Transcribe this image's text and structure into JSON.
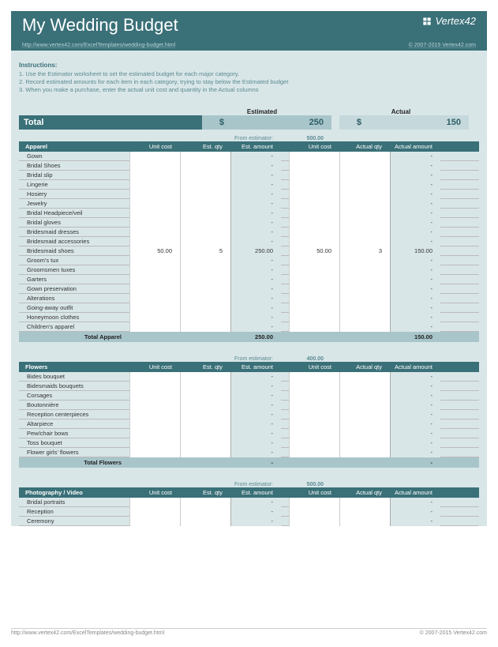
{
  "header": {
    "title": "My Wedding Budget",
    "logo": "Vertex42",
    "url": "http://www.vertex42.com/ExcelTemplates/wedding-budget.html",
    "copyright": "© 2007-2015 Vertex42.com"
  },
  "instructions": {
    "heading": "Instructions:",
    "lines": [
      "1. Use the Estimator worksheet to set the estimated budget for each major category.",
      "2. Record estimated amounts for each item in each category, trying to stay below the Estimated budget",
      "3. When you make a purchase, enter the actual unit cost and quantity in the Actual columns"
    ]
  },
  "totals": {
    "est_label": "Estimated",
    "act_label": "Actual",
    "label": "Total",
    "cur": "$",
    "est": "250",
    "act": "150"
  },
  "cols": {
    "unit_cost": "Unit cost",
    "est_qty": "Est. qty",
    "est_amt": "Est. amount",
    "act_unit": "Unit cost",
    "act_qty": "Actual qty",
    "act_amt": "Actual amount"
  },
  "estimator_label": "From estimator:",
  "categories": [
    {
      "name": "Apparel",
      "from_estimator": "500.00",
      "items": [
        {
          "name": "Gown",
          "uc": "",
          "eq": "",
          "ea": "-",
          "au": "",
          "aq": "",
          "aa": "-"
        },
        {
          "name": "Bridal Shoes",
          "uc": "",
          "eq": "",
          "ea": "-",
          "au": "",
          "aq": "",
          "aa": "-"
        },
        {
          "name": "Bridal slip",
          "uc": "",
          "eq": "",
          "ea": "-",
          "au": "",
          "aq": "",
          "aa": "-"
        },
        {
          "name": "Lingerie",
          "uc": "",
          "eq": "",
          "ea": "-",
          "au": "",
          "aq": "",
          "aa": "-"
        },
        {
          "name": "Hosiery",
          "uc": "",
          "eq": "",
          "ea": "-",
          "au": "",
          "aq": "",
          "aa": "-"
        },
        {
          "name": "Jewelry",
          "uc": "",
          "eq": "",
          "ea": "-",
          "au": "",
          "aq": "",
          "aa": "-"
        },
        {
          "name": "Bridal Headpiece/veil",
          "uc": "",
          "eq": "",
          "ea": "-",
          "au": "",
          "aq": "",
          "aa": "-"
        },
        {
          "name": "Bridal gloves",
          "uc": "",
          "eq": "",
          "ea": "-",
          "au": "",
          "aq": "",
          "aa": "-"
        },
        {
          "name": "Bridesmaid dresses",
          "uc": "",
          "eq": "",
          "ea": "-",
          "au": "",
          "aq": "",
          "aa": "-"
        },
        {
          "name": "Bridesmaid accessories",
          "uc": "",
          "eq": "",
          "ea": "-",
          "au": "",
          "aq": "",
          "aa": "-"
        },
        {
          "name": "Bridesmaid shoes",
          "uc": "50.00",
          "eq": "5",
          "ea": "250.00",
          "au": "50.00",
          "aq": "3",
          "aa": "150.00"
        },
        {
          "name": "Groom's tux",
          "uc": "",
          "eq": "",
          "ea": "-",
          "au": "",
          "aq": "",
          "aa": "-"
        },
        {
          "name": "Groomsmen tuxes",
          "uc": "",
          "eq": "",
          "ea": "-",
          "au": "",
          "aq": "",
          "aa": "-"
        },
        {
          "name": "Garters",
          "uc": "",
          "eq": "",
          "ea": "-",
          "au": "",
          "aq": "",
          "aa": "-"
        },
        {
          "name": "Gown preservation",
          "uc": "",
          "eq": "",
          "ea": "-",
          "au": "",
          "aq": "",
          "aa": "-"
        },
        {
          "name": "Alterations",
          "uc": "",
          "eq": "",
          "ea": "-",
          "au": "",
          "aq": "",
          "aa": "-"
        },
        {
          "name": "Going-away outfit",
          "uc": "",
          "eq": "",
          "ea": "-",
          "au": "",
          "aq": "",
          "aa": "-"
        },
        {
          "name": "Honeymoon clothes",
          "uc": "",
          "eq": "",
          "ea": "-",
          "au": "",
          "aq": "",
          "aa": "-"
        },
        {
          "name": "Children's apparel",
          "uc": "",
          "eq": "",
          "ea": "-",
          "au": "",
          "aq": "",
          "aa": "-"
        }
      ],
      "subtotal": {
        "label": "Total Apparel",
        "est": "250.00",
        "act": "150.00"
      }
    },
    {
      "name": "Flowers",
      "from_estimator": "400.00",
      "items": [
        {
          "name": "Bides bouquet",
          "uc": "",
          "eq": "",
          "ea": "-",
          "au": "",
          "aq": "",
          "aa": "-"
        },
        {
          "name": "Bidesmaids bouquets",
          "uc": "",
          "eq": "",
          "ea": "-",
          "au": "",
          "aq": "",
          "aa": "-"
        },
        {
          "name": "Corsages",
          "uc": "",
          "eq": "",
          "ea": "-",
          "au": "",
          "aq": "",
          "aa": "-"
        },
        {
          "name": "Boutonnière",
          "uc": "",
          "eq": "",
          "ea": "-",
          "au": "",
          "aq": "",
          "aa": "-"
        },
        {
          "name": "Reception centerpieces",
          "uc": "",
          "eq": "",
          "ea": "-",
          "au": "",
          "aq": "",
          "aa": "-"
        },
        {
          "name": "Altarpiece",
          "uc": "",
          "eq": "",
          "ea": "-",
          "au": "",
          "aq": "",
          "aa": "-"
        },
        {
          "name": "Pew/chair bows",
          "uc": "",
          "eq": "",
          "ea": "-",
          "au": "",
          "aq": "",
          "aa": "-"
        },
        {
          "name": "Toss bouquet",
          "uc": "",
          "eq": "",
          "ea": "-",
          "au": "",
          "aq": "",
          "aa": "-"
        },
        {
          "name": "Flower girls' flowers",
          "uc": "",
          "eq": "",
          "ea": "-",
          "au": "",
          "aq": "",
          "aa": "-"
        }
      ],
      "subtotal": {
        "label": "Total Flowers",
        "est": "-",
        "act": "-"
      }
    },
    {
      "name": "Photography / Video",
      "from_estimator": "500.00",
      "items": [
        {
          "name": "Bridal portraits",
          "uc": "",
          "eq": "",
          "ea": "-",
          "au": "",
          "aq": "",
          "aa": "-"
        },
        {
          "name": "Reception",
          "uc": "",
          "eq": "",
          "ea": "-",
          "au": "",
          "aq": "",
          "aa": "-"
        },
        {
          "name": "Ceremony",
          "uc": "",
          "eq": "",
          "ea": "-",
          "au": "",
          "aq": "",
          "aa": "-"
        }
      ],
      "subtotal": null
    }
  ],
  "footer": {
    "url": "http://www.vertex42.com/ExcelTemplates/wedding-budget.html",
    "copyright": "© 2007-2015 Vertex42.com"
  }
}
